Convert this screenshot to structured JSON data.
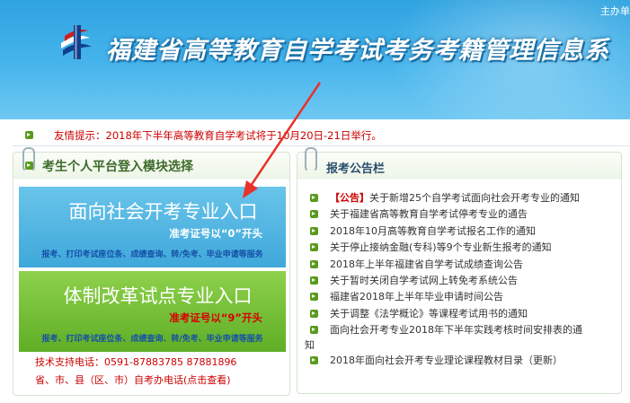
{
  "header": {
    "sponsor": "主办单",
    "site_title": "福建省高等教育自学考试考务考籍管理信息系"
  },
  "notice": {
    "text": "友情提示：2018年下半年高等教育自学考试将于10月20日-21日举行。"
  },
  "login_panel": {
    "title": "考生个人平台登入模块选择",
    "social": {
      "title": "面向社会开考专业入口",
      "sub": "准考证号以“0”开头",
      "services": "报考、打印考试座位条、成绩查询、转/免考、毕业申请等服务"
    },
    "reform": {
      "title": "体制改革试点专业入口",
      "sub": "准考证号以“9”开头",
      "services": "报考、打印考试座位条、成绩查询、转/免考、毕业申请等服务"
    },
    "support_phone": "技术支持电话：0591-87883785 87881896",
    "local_offices": "省、市、县（区、市）自考办电话(点击查看)"
  },
  "news_panel": {
    "title": "报考公告栏",
    "items": [
      {
        "tag": "【公告】",
        "text": "关于新增25个自学考试面向社会开考专业的通知"
      },
      {
        "tag": "",
        "text": " 关于福建省高等教育自学考试停考专业的通告"
      },
      {
        "tag": "",
        "text": "2018年10月高等教育自学考试报名工作的通知"
      },
      {
        "tag": "",
        "text": "关于停止接纳金融(专科)等9个专业新生报考的通知"
      },
      {
        "tag": "",
        "text": "2018年上半年福建省自学考试成绩查询公告"
      },
      {
        "tag": "",
        "text": "关于暂时关闭自学考试网上转免考系统公告"
      },
      {
        "tag": "",
        "text": "福建省2018年上半年毕业申请时间公告"
      },
      {
        "tag": "",
        "text": "关于调整《法学概论》等课程考试用书的通知"
      },
      {
        "tag": "",
        "text": "面向社会开考专业2018年下半年实践考核时间安排表的通",
        "text2": "知"
      },
      {
        "tag": "",
        "text": "2018年面向社会开考专业理论课程教材目录（更新）"
      }
    ]
  },
  "colors": {
    "header_blue": "#47b5ec",
    "notice_red": "#cc0000",
    "block_blue": "#3fa8da",
    "block_green": "#5fae25",
    "bullet_green": "#5a9a1e"
  }
}
